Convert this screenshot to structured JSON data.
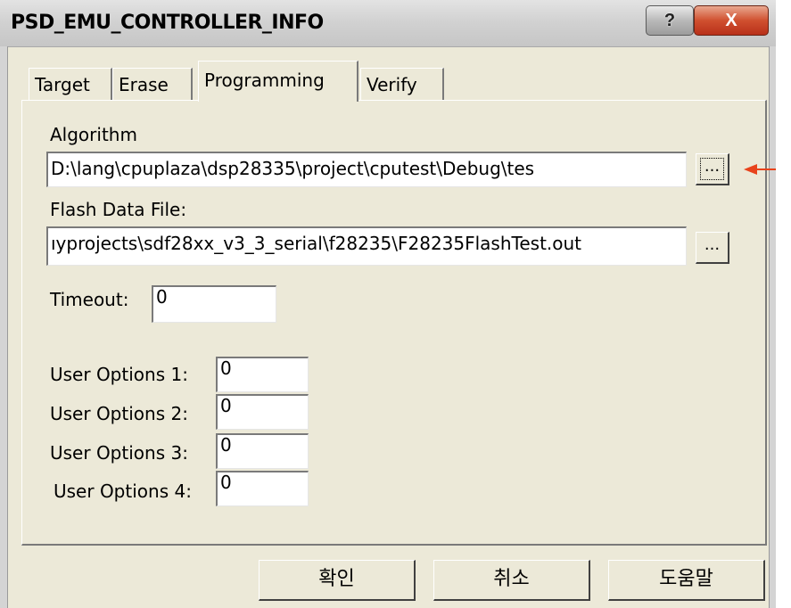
{
  "window": {
    "title": "PSD_EMU_CONTROLLER_INFO",
    "help_label": "?",
    "close_label": "X"
  },
  "tabs": [
    {
      "label": "Target"
    },
    {
      "label": "Erase"
    },
    {
      "label": "Programming"
    },
    {
      "label": "Verify"
    }
  ],
  "selected_tab": "Programming",
  "form": {
    "algorithm_label": "Algorithm",
    "algorithm_value": "D:\\lang\\cpuplaza\\dsp28335\\project\\cputest\\Debug\\tes",
    "algorithm_browse": "...",
    "flash_label": "Flash Data File:",
    "flash_value": "ıyprojects\\sdf28xx_v3_3_serial\\f28235\\F28235FlashTest.out",
    "flash_browse": "...",
    "timeout_label": "Timeout:",
    "timeout_value": "0",
    "user_options": [
      {
        "label": "User Options 1:",
        "value": "0"
      },
      {
        "label": "User Options 2:",
        "value": "0"
      },
      {
        "label": "User Options 3:",
        "value": "0"
      },
      {
        "label": "User Options 4:",
        "value": "0"
      }
    ]
  },
  "buttons": {
    "ok": "확인",
    "cancel": "취소",
    "help": "도움말"
  },
  "colors": {
    "dialog_face": "#ece9d8",
    "annotation_arrow": "#e8431c"
  }
}
